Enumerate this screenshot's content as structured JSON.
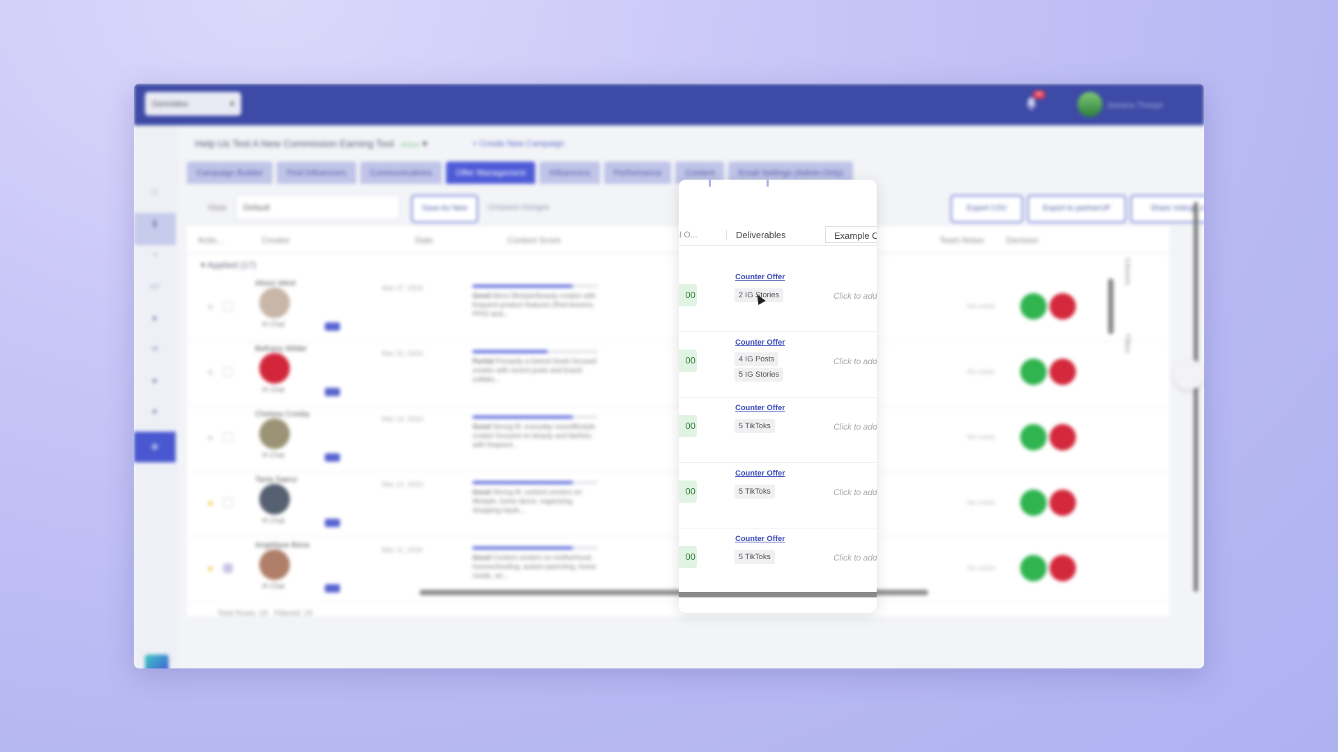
{
  "topbar": {
    "workspace": "Gennideo",
    "notifications_count": "99",
    "user_name": "Jessica Thorpe"
  },
  "campaign": {
    "title": "Help Us Test A New Commission Earning Tool",
    "status": "Active",
    "create_new": "+ Create New Campaign"
  },
  "tabs": [
    {
      "label": "Campaign Builder"
    },
    {
      "label": "Find Influencers"
    },
    {
      "label": "Communications"
    },
    {
      "label": "Offer Management",
      "active": true
    },
    {
      "label": "Influencers"
    },
    {
      "label": "Performance"
    },
    {
      "label": "Content"
    },
    {
      "label": "Email Settings (Admin-Only)"
    }
  ],
  "toolbar": {
    "view_label": "View:",
    "view_value": "Default",
    "save_as_new": "Save As New",
    "unsaved": "Unsaved changes",
    "export_csv": "Export CSV",
    "export_partner": "Export to partnerUP",
    "share_link": "Share Voting Link"
  },
  "table": {
    "headers": {
      "actions": "Actio...",
      "creator": "Creator",
      "date": "Date",
      "content_score": "Content Score",
      "initial_offer": "Initial O...",
      "deliverables": "Deliverables",
      "example_content": "Example Content",
      "team_notes": "Team Notes",
      "decision": "Decision"
    },
    "group": "Applied (17)",
    "rows": [
      {
        "creator": "Alison West",
        "date": "Mar 27, 2024",
        "score_label": "Good",
        "score_text": "Micro lifestyle/beauty creator with frequent product features (Red Aveeno, PPIO and...",
        "initial": "00",
        "counter": "Counter Offer",
        "deliverables": [
          "2 IG Stories"
        ],
        "example": "Click to add...",
        "notes": "No notes"
      },
      {
        "creator": "Bethany Wilder",
        "date": "Mar 22, 2024",
        "score_label": "Partial",
        "score_text": "Primarily a Detroit foods focused creator with recent posts and brand collabs...",
        "initial": "00",
        "counter": "Counter Offer",
        "deliverables": [
          "4 IG Posts",
          "5 IG Stories"
        ],
        "example": "Click to add...",
        "notes": "No notes"
      },
      {
        "creator": "Chelsea Crosby",
        "date": "Mar 14, 2024",
        "score_label": "Good",
        "score_text": "Strong fit: everyday mom/lifestyle creator focused on beauty and fashion, with frequent...",
        "initial": "00",
        "counter": "Counter Offer",
        "deliverables": [
          "5 TikToks"
        ],
        "example": "Click to add...",
        "notes": "No notes"
      },
      {
        "creator": "Tania Saenz",
        "date": "Mar 12, 2024",
        "score_label": "Good",
        "score_text": "Strong fit: content centers on lifestyle, home decor, organizing, shopping hauls...",
        "initial": "00",
        "counter": "Counter Offer",
        "deliverables": [
          "5 TikToks"
        ],
        "example": "Click to add...",
        "notes": "No notes"
      },
      {
        "creator": "Angelique Bona",
        "date": "Mar 11, 2024",
        "score_label": "Good",
        "score_text": "Content centers on motherhood, homeschooling, autism parenting, home meals, an...",
        "initial": "00",
        "counter": "Counter Offer",
        "deliverables": [
          "5 TikToks"
        ],
        "example": "Click to add...",
        "notes": "No notes"
      }
    ],
    "chat": "Chat",
    "total_rows": "Total Rows: 29",
    "filtered": "Filtered: 29"
  },
  "side_panel": {
    "columns": "Columns",
    "filters": "Filters"
  }
}
